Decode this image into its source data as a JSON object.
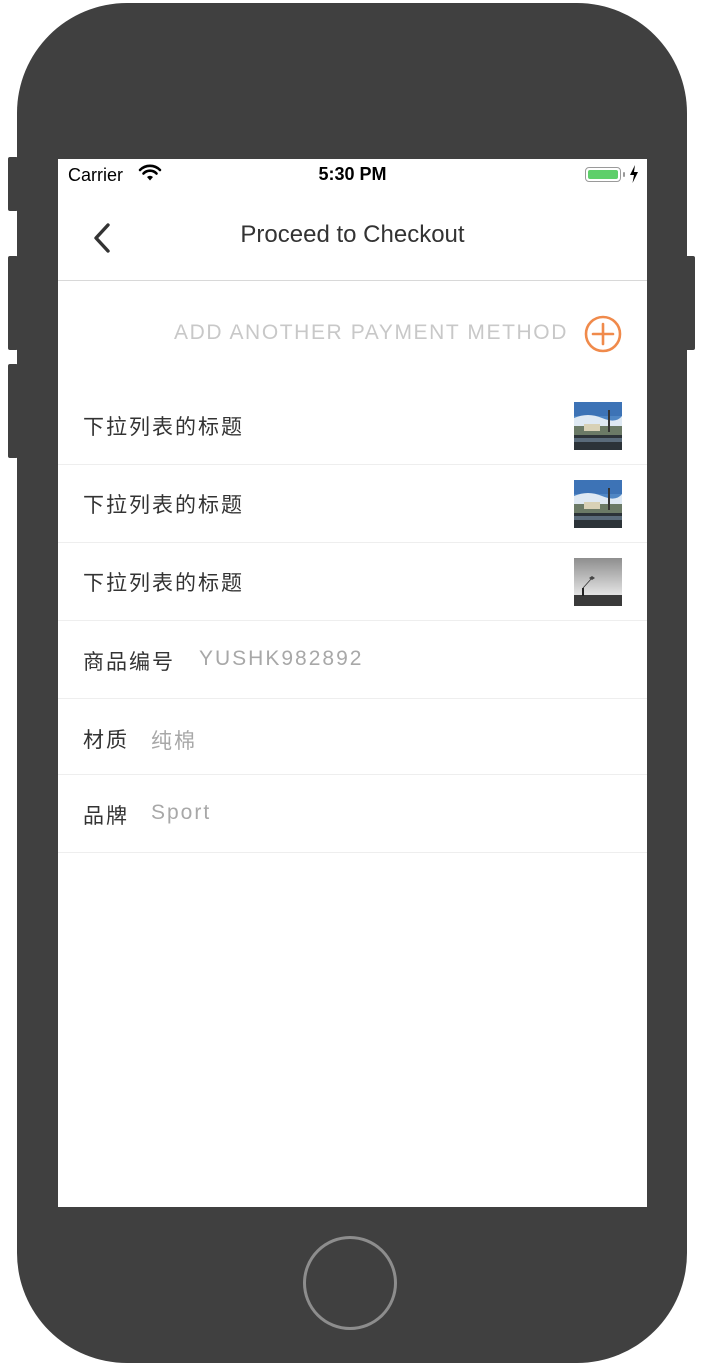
{
  "status_bar": {
    "carrier": "Carrier",
    "time": "5:30 PM"
  },
  "nav": {
    "title": "Proceed to Checkout"
  },
  "payment": {
    "add_label": "ADD ANOTHER PAYMENT METHOD",
    "accent_color": "#f08a4b"
  },
  "dropdown_items": [
    {
      "title": "下拉列表的标题",
      "thumbnail": "street-scene-photo"
    },
    {
      "title": "下拉列表的标题",
      "thumbnail": "street-scene-photo"
    },
    {
      "title": "下拉列表的标题",
      "thumbnail": "grey-sky-photo"
    }
  ],
  "product": {
    "sku_label": "商品编号",
    "sku_value": "YUSHK982892",
    "material_label": "材质",
    "material_value": "纯棉",
    "brand_label": "品牌",
    "brand_value": "Sport"
  }
}
